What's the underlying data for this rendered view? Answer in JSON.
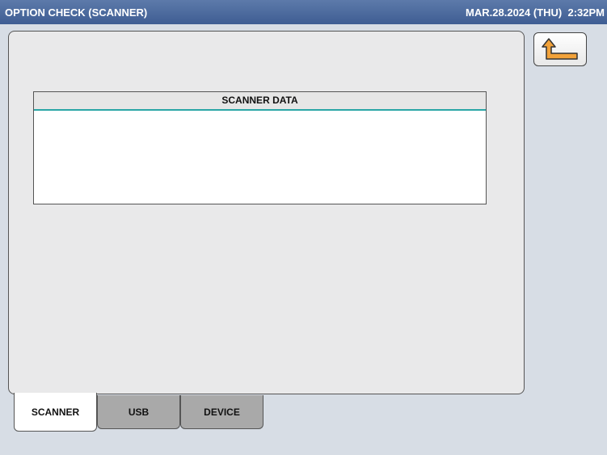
{
  "header": {
    "title": "OPTION CHECK (SCANNER)",
    "datetime": "MAR.28.2024 (THU)  2:32PM"
  },
  "panel": {
    "data_box_title": "SCANNER DATA"
  },
  "tabs": [
    {
      "label": "SCANNER",
      "active": true
    },
    {
      "label": "USB",
      "active": false
    },
    {
      "label": "DEVICE",
      "active": false
    }
  ],
  "colors": {
    "titlebar": "#4a6a9e",
    "accent_line": "#2aa6a6",
    "back_arrow": "#f2a23a"
  },
  "icons": {
    "back": "return-arrow-icon"
  }
}
